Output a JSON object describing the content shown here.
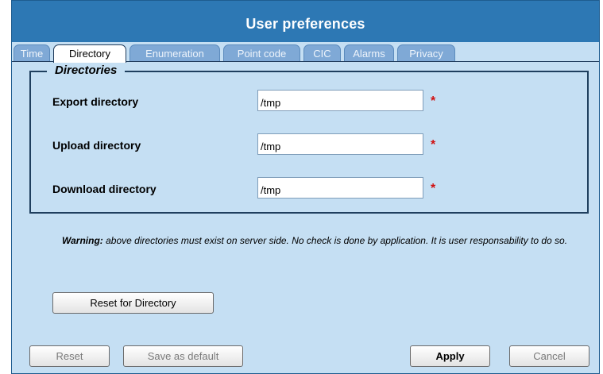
{
  "window": {
    "title": "User preferences"
  },
  "tabs": [
    {
      "label": "Time",
      "active": false
    },
    {
      "label": "Directory",
      "active": true
    },
    {
      "label": "Enumeration",
      "active": false
    },
    {
      "label": "Point code",
      "active": false
    },
    {
      "label": "CIC",
      "active": false
    },
    {
      "label": "Alarms",
      "active": false
    },
    {
      "label": "Privacy",
      "active": false
    }
  ],
  "directories": {
    "legend": "Directories",
    "rows": [
      {
        "label": "Export directory",
        "value": "/tmp",
        "required": "*"
      },
      {
        "label": "Upload directory",
        "value": "/tmp",
        "required": "*"
      },
      {
        "label": "Download directory",
        "value": "/tmp",
        "required": "*"
      }
    ]
  },
  "warning": {
    "prefix": "Warning:",
    "text": " above directories must exist on server side. No check is done by application. It is user responsability to do so."
  },
  "buttons": {
    "reset_directory": "Reset for Directory",
    "reset": "Reset",
    "save_default": "Save as default",
    "apply": "Apply",
    "cancel": "Cancel"
  },
  "colors": {
    "titlebar": "#2d78b4",
    "panel": "#c5dff3",
    "inactive_tab": "#7fa9d6",
    "required_star": "#d01010"
  }
}
